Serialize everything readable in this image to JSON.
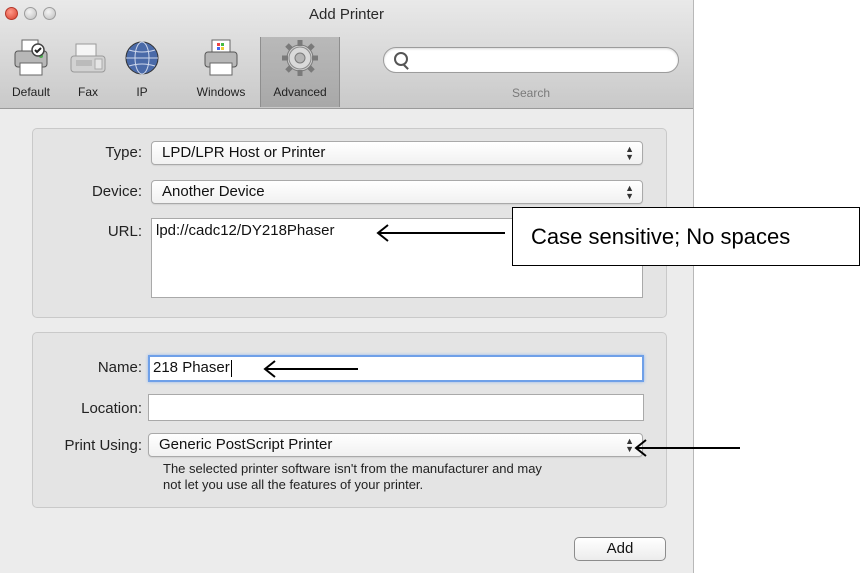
{
  "window": {
    "title": "Add Printer"
  },
  "toolbar": {
    "items": [
      {
        "label": "Default",
        "icon": "printer-icon"
      },
      {
        "label": "Fax",
        "icon": "fax-icon"
      },
      {
        "label": "IP",
        "icon": "globe-icon"
      },
      {
        "label": "Windows",
        "icon": "windows-printer-icon"
      },
      {
        "label": "Advanced",
        "icon": "gear-icon",
        "selected": true
      }
    ],
    "search_label": "Search",
    "search_placeholder": ""
  },
  "connection": {
    "type_label": "Type:",
    "type_value": "LPD/LPR Host or Printer",
    "device_label": "Device:",
    "device_value": "Another Device",
    "url_label": "URL:",
    "url_value": "lpd://cadc12/DY218Phaser"
  },
  "printer": {
    "name_label": "Name:",
    "name_value": "218 Phaser",
    "location_label": "Location:",
    "location_value": "",
    "print_using_label": "Print Using:",
    "print_using_value": "Generic PostScript Printer",
    "note_line1": "The selected printer software isn't from the manufacturer and may",
    "note_line2": "not let you use all the features of your printer."
  },
  "actions": {
    "add_label": "Add"
  },
  "annotation": {
    "callout_text": "Case sensitive; No spaces"
  },
  "colors": {
    "focus_ring": "#6fa0e8",
    "window_bg": "#ececec"
  }
}
